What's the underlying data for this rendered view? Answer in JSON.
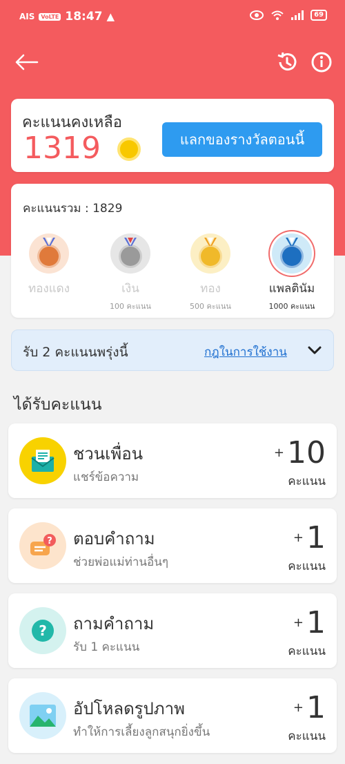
{
  "status_bar": {
    "carrier": "AIS",
    "network_badge": "VoLTE",
    "time": "18:47",
    "battery": "69"
  },
  "balance": {
    "label": "คะแนนคงเหลือ",
    "value": "1319",
    "redeem_button": "แลกของรางวัลตอนนี้"
  },
  "levels": {
    "total_label": "คะแนนรวม : 1829",
    "tiers": [
      {
        "name": "ทองแดง",
        "requirement": "",
        "color": "#e07a3b",
        "bg": "#fbe3d3"
      },
      {
        "name": "เงิน",
        "requirement": "100 คะแนน",
        "color": "#9a9a9a",
        "bg": "#e6e6e6"
      },
      {
        "name": "ทอง",
        "requirement": "500 คะแนน",
        "color": "#f0b92a",
        "bg": "#fcefc4"
      },
      {
        "name": "แพลตินัม",
        "requirement": "1000 คะแนน",
        "color": "#1d6fc0",
        "bg": "#cfeaf8"
      }
    ],
    "active_tier_index": 3
  },
  "tomorrow": {
    "text": "รับ 2 คะแนนพรุ่งนี้",
    "rules_link": "กฎในการใช้งาน"
  },
  "earn_section": {
    "title": "ได้รับคะแนน",
    "tasks": [
      {
        "title": "ชวนเพื่อน",
        "subtitle": "แชร์ข้อความ",
        "plus": "+",
        "points": "10",
        "unit": "คะแนน",
        "icon": "envelope-icon"
      },
      {
        "title": "ตอบคำถาม",
        "subtitle": "ช่วยพ่อแม่ท่านอื่นๆ",
        "plus": "+",
        "points": "1",
        "unit": "คะแนน",
        "icon": "answer-bubble-icon"
      },
      {
        "title": "ถามคำถาม",
        "subtitle": "รับ 1 คะแนน",
        "plus": "+",
        "points": "1",
        "unit": "คะแนน",
        "icon": "question-icon"
      },
      {
        "title": "อัปโหลดรูปภาพ",
        "subtitle": "ทำให้การเลี้ยงลูกสนุกยิ่งขึ้น",
        "plus": "+",
        "points": "1",
        "unit": "คะแนน",
        "icon": "image-icon"
      }
    ]
  },
  "colors": {
    "header": "#f45b5e",
    "accent_blue": "#2e9bf0",
    "balance_value": "#f45b5e"
  }
}
